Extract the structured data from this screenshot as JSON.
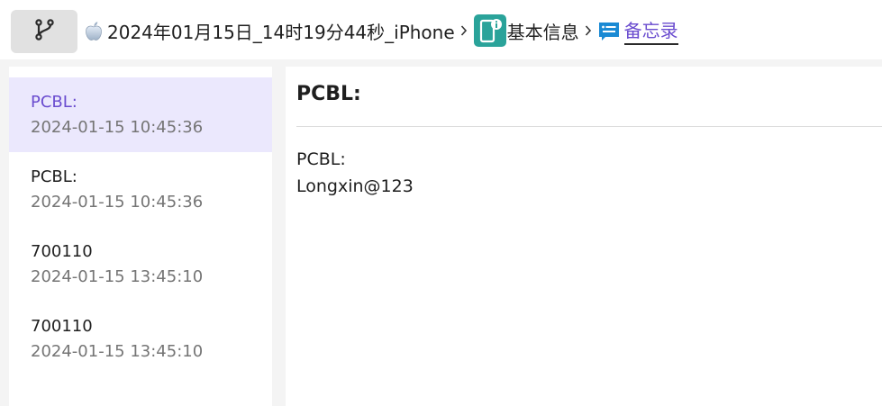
{
  "header": {
    "branch_icon": "git-branch-icon",
    "crumbs": [
      {
        "label": "2024年01月15日_14时19分44秒_iPhone",
        "icon": "apple-icon"
      },
      {
        "label": "基本信息",
        "icon": "device-info-icon"
      },
      {
        "label": "备忘录",
        "icon": "notes-icon",
        "active": true
      }
    ],
    "separator_icon": "chevron-right-icon",
    "accent_color": "#6a4ccf",
    "info_icon_color": "#2aa39a",
    "notes_icon_color": "#1a8ad4"
  },
  "notes_list": {
    "selected_bg": "#ebe8fd",
    "items": [
      {
        "title": "PCBL:",
        "time": "2024-01-15 10:45:36",
        "selected": true
      },
      {
        "title": "PCBL:",
        "time": "2024-01-15 10:45:36",
        "selected": false
      },
      {
        "title": "700110",
        "time": "2024-01-15 13:45:10",
        "selected": false
      },
      {
        "title": "700110",
        "time": "2024-01-15 13:45:10",
        "selected": false
      }
    ]
  },
  "detail": {
    "title": "PCBL:",
    "lines": [
      "PCBL:",
      "Longxin@123"
    ]
  }
}
